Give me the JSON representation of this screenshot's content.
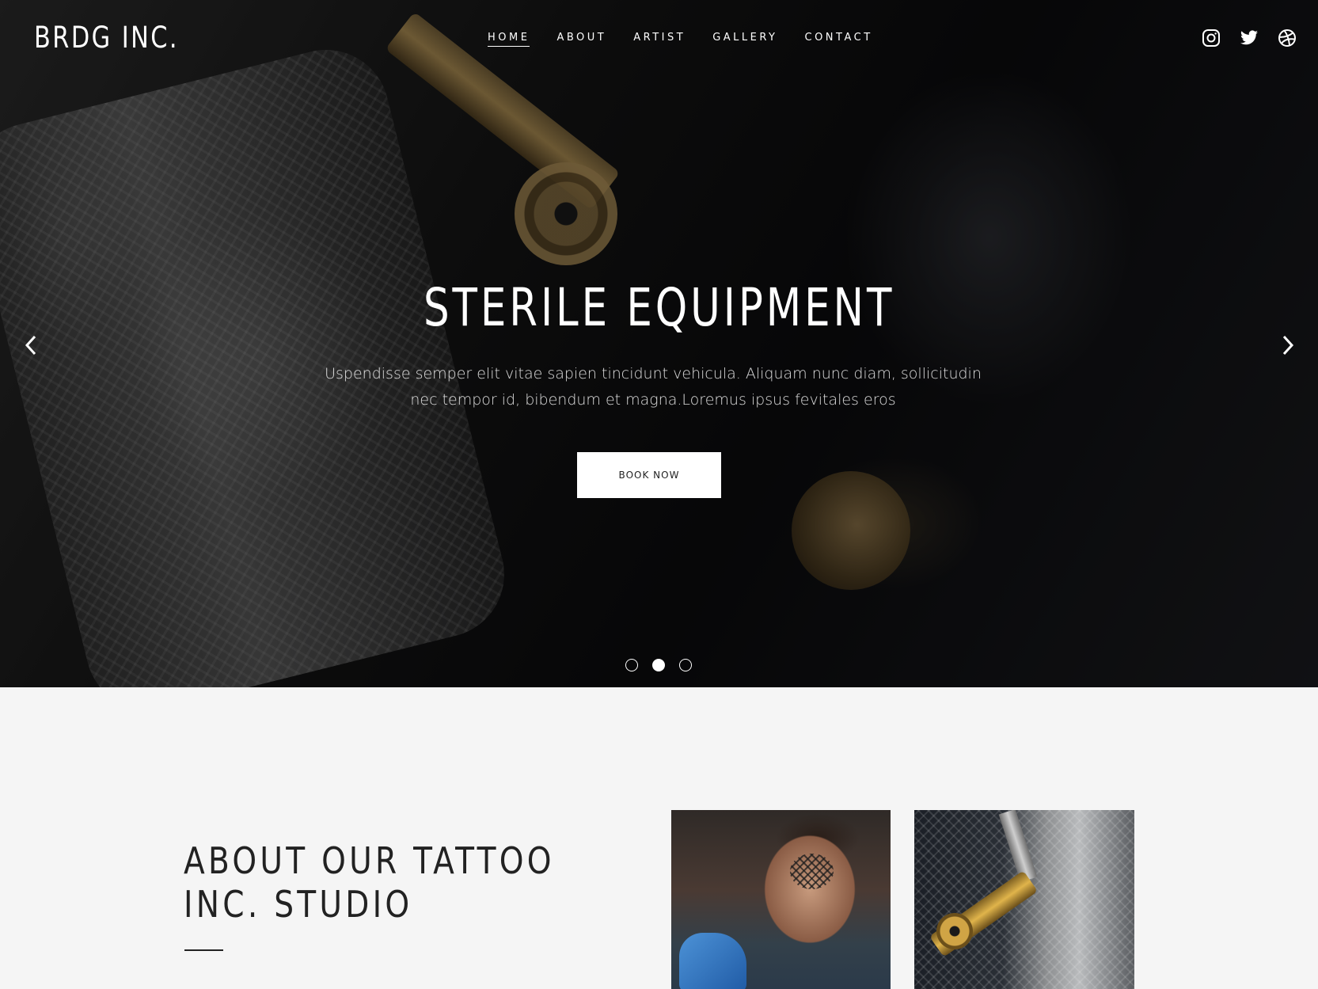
{
  "brand": {
    "logo": "BRDG INC."
  },
  "nav": {
    "items": [
      {
        "label": "HOME",
        "active": true
      },
      {
        "label": "ABOUT",
        "active": false
      },
      {
        "label": "ARTIST",
        "active": false
      },
      {
        "label": "GALLERY",
        "active": false
      },
      {
        "label": "CONTACT",
        "active": false
      }
    ]
  },
  "social": {
    "icons": [
      "instagram-icon",
      "twitter-icon",
      "dribbble-icon"
    ]
  },
  "hero": {
    "headline": "STERILE EQUIPMENT",
    "subtext": "Uspendisse semper elit vitae sapien tincidunt vehicula. Aliquam nunc diam, sollicitudin nec tempor id, bibendum et magna.Loremus ipsus fevitales eros",
    "cta_label": "BOOK NOW",
    "slides_total": 3,
    "active_slide": 2
  },
  "about": {
    "title_line1": "ABOUT OUR TATTOO",
    "title_line2": "INC. STUDIO"
  },
  "colors": {
    "background": "#f5f5f5",
    "hero_text": "#ffffff",
    "heading_dark": "#222222"
  }
}
